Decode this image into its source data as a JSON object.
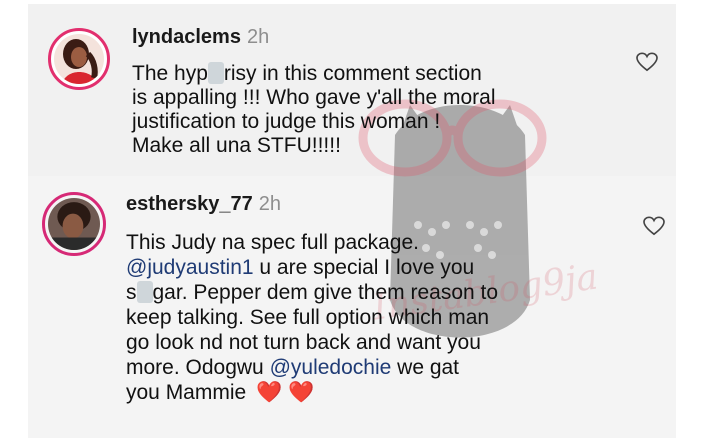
{
  "comments": [
    {
      "username": "lyndaclems",
      "time": "2h",
      "lines": [
        "The hyp[mask]risy in this comment section",
        "is appalling !!! Who gave y'all the moral",
        "justification to judge this woman !",
        "Make all una STFU!!!!!"
      ],
      "line1_a": "The hyp",
      "line1_b": "risy in this comment section",
      "line2": "is appalling !!! Who gave y'all the moral",
      "line3": "justification to judge this woman !",
      "line4": "Make all una STFU!!!!!",
      "avatar_icon": "profile-photo",
      "like_icon": "heart-outline-icon"
    },
    {
      "username": "esthersky_77",
      "time": "2h",
      "line1": "This Judy na spec full package.",
      "line2_mention": "@judyaustin1",
      "line2_rest": " u are special I love you",
      "line3_a": "s",
      "line3_b": "gar. Pepper dem give them reason to",
      "line4": "keep talking. See full option which man",
      "line5": "go look nd not turn back and want you",
      "line6_a": "more.  Odogwu ",
      "line6_mention": "@yuledochie",
      "line6_b": "  we gat",
      "line7": "you Mammie",
      "hearts": "❤️ ❤️",
      "avatar_icon": "profile-photo",
      "like_icon": "heart-outline-icon"
    }
  ],
  "watermark": {
    "text": "Instablog9ja",
    "icon": "owl-logo"
  },
  "colors": {
    "panel": "#f1f1f1",
    "mention": "#1f3b75",
    "time": "#8e8e8e",
    "avatar_ring": "#e22f6e",
    "heart": "#e02626"
  }
}
